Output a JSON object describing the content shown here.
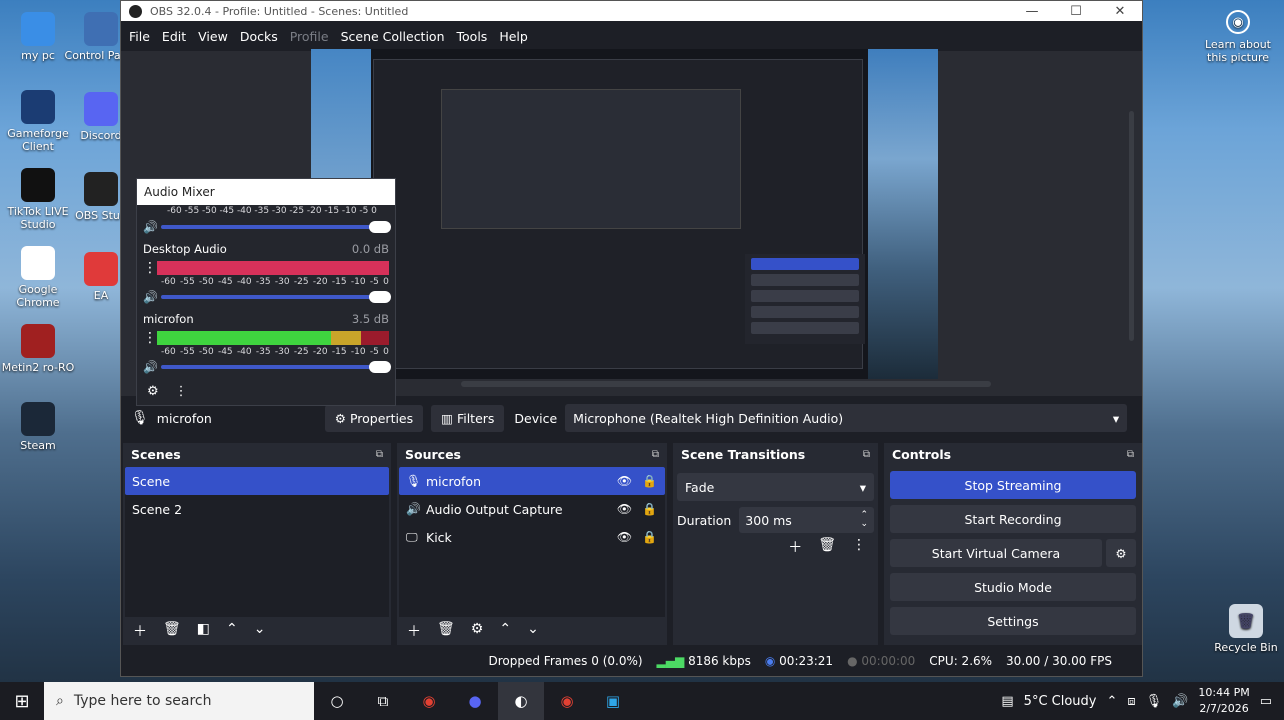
{
  "desktop": {
    "icons_left": [
      {
        "label": "my pc",
        "icon": "computer-icon"
      },
      {
        "label": "Gameforge Client",
        "icon": "gameforge-icon"
      },
      {
        "label": "TikTok LIVE Studio",
        "icon": "tiktok-icon"
      },
      {
        "label": "Google Chrome",
        "icon": "chrome-icon"
      },
      {
        "label": "Metin2 ro-RO",
        "icon": "metin2-icon"
      },
      {
        "label": "Steam",
        "icon": "steam-icon"
      }
    ],
    "icons_col2": [
      {
        "label": "Control Panel",
        "icon": "control-panel-icon"
      },
      {
        "label": "Discord",
        "icon": "discord-icon"
      },
      {
        "label": "OBS Stud",
        "icon": "obs-icon"
      },
      {
        "label": "EA",
        "icon": "ea-icon"
      }
    ],
    "learn_about": "Learn about this picture",
    "recycle_bin": "Recycle Bin"
  },
  "window": {
    "title": "OBS 32.0.4 - Profile: Untitled - Scenes: Untitled",
    "menu": [
      "File",
      "Edit",
      "View",
      "Docks",
      "Profile",
      "Scene Collection",
      "Tools",
      "Help"
    ]
  },
  "mixer": {
    "title": "Audio Mixer",
    "scale": [
      "-60",
      "-55",
      "-50",
      "-45",
      "-40",
      "-35",
      "-30",
      "-25",
      "-20",
      "-15",
      "-10",
      "-5",
      "0"
    ],
    "channels": [
      {
        "name": "Desktop Audio",
        "db": "0.0 dB",
        "level": 1.0,
        "color": "#d7315a"
      },
      {
        "name": "microfon",
        "db": "3.5 dB",
        "level": 0.85,
        "color": "#3fd43f"
      }
    ]
  },
  "source_toolbar": {
    "source_name": "microfon",
    "properties": "Properties",
    "filters": "Filters",
    "device_label": "Device",
    "device_value": "Microphone (Realtek High Definition Audio)"
  },
  "scenes": {
    "title": "Scenes",
    "items": [
      "Scene",
      "Scene 2"
    ]
  },
  "sources": {
    "title": "Sources",
    "items": [
      {
        "name": "microfon",
        "icon": "microphone-icon"
      },
      {
        "name": "Audio Output Capture",
        "icon": "speaker-icon"
      },
      {
        "name": "Kick",
        "icon": "monitor-icon"
      }
    ]
  },
  "transitions": {
    "title": "Scene Transitions",
    "selected": "Fade",
    "duration_label": "Duration",
    "duration_value": "300 ms"
  },
  "controls": {
    "title": "Controls",
    "stop_streaming": "Stop Streaming",
    "start_recording": "Start Recording",
    "start_virtual_camera": "Start Virtual Camera",
    "studio_mode": "Studio Mode",
    "settings": "Settings"
  },
  "status": {
    "dropped_frames": "Dropped Frames 0 (0.0%)",
    "bitrate": "8186 kbps",
    "stream_time": "00:23:21",
    "record_time": "00:00:00",
    "cpu": "CPU: 2.6%",
    "fps": "30.00 / 30.00 FPS"
  },
  "taskbar": {
    "search_placeholder": "Type here to search",
    "weather": "5°C  Cloudy",
    "time": "10:44 PM",
    "date": "2/7/2026"
  }
}
